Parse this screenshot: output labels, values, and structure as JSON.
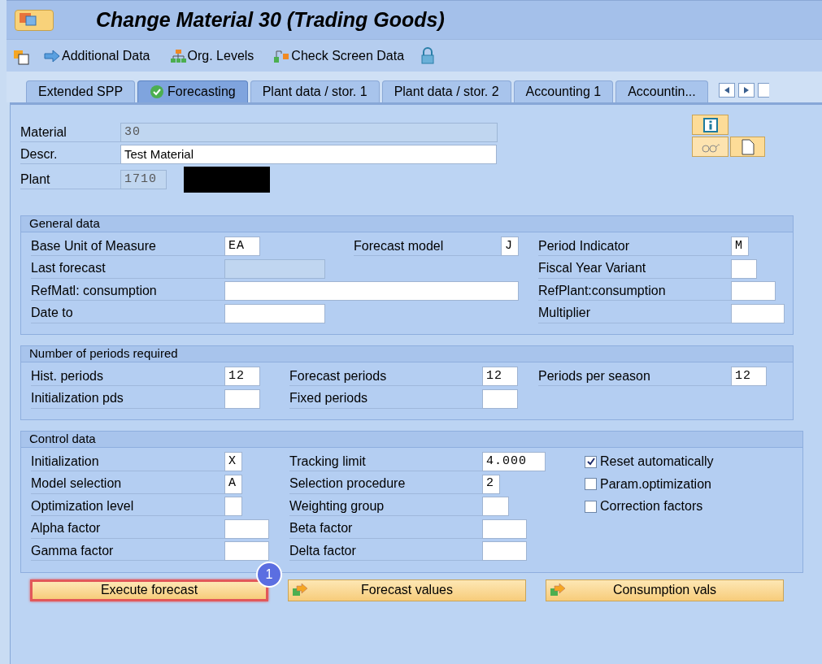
{
  "window": {
    "title": "Change Material 30 (Trading Goods)"
  },
  "toolbar": [
    {
      "kind": "icon"
    },
    {
      "label": "Additional Data",
      "kind": "arrow"
    },
    {
      "label": "Org. Levels",
      "kind": "tree"
    },
    {
      "label": "Check Screen Data",
      "kind": "check"
    },
    {
      "kind": "lock"
    }
  ],
  "tabs": [
    {
      "label": "Extended SPP",
      "selected": false
    },
    {
      "label": "Forecasting",
      "selected": true
    },
    {
      "label": "Plant data / stor. 1",
      "selected": false
    },
    {
      "label": "Plant data / stor. 2",
      "selected": false
    },
    {
      "label": "Accounting 1",
      "selected": false
    },
    {
      "label": "Accountin...",
      "selected": false
    }
  ],
  "header": [
    {
      "label": "Material",
      "value": "30",
      "disabled": true
    },
    {
      "label": "Descr.",
      "value": "Test Material",
      "disabled": false
    },
    {
      "label": "Plant",
      "value": "1710",
      "disabled": true
    }
  ],
  "sections": [
    {
      "title": "General data",
      "columns": [
        [
          {
            "kind": "field",
            "label": "Base Unit of Measure",
            "value": "EA",
            "disabled": false
          },
          {
            "kind": "field",
            "label": "Last forecast",
            "disabled": true
          },
          {
            "kind": "field",
            "label": "RefMatl: consumption",
            "disabled": false
          },
          {
            "kind": "field",
            "label": "Date to",
            "disabled": false
          }
        ],
        [
          {
            "kind": "field",
            "label": "Forecast model",
            "value": "J",
            "disabled": false
          }
        ],
        [
          {
            "kind": "field",
            "label": "Period Indicator",
            "value": "M",
            "disabled": false
          },
          {
            "kind": "field",
            "label": "Fiscal Year Variant",
            "disabled": false
          },
          {
            "kind": "field",
            "label": "RefPlant:consumption",
            "disabled": false
          },
          {
            "kind": "field",
            "label": "Multiplier",
            "disabled": false
          }
        ]
      ]
    },
    {
      "title": "Number of periods required",
      "columns": [
        [
          {
            "kind": "field",
            "label": "Hist. periods",
            "value": "12",
            "disabled": false
          },
          {
            "kind": "field",
            "label": "Initialization pds",
            "disabled": false
          }
        ],
        [
          {
            "kind": "field",
            "label": "Forecast periods",
            "value": "12",
            "disabled": false
          },
          {
            "kind": "field",
            "label": "Fixed periods",
            "disabled": false
          }
        ],
        [
          {
            "kind": "field",
            "label": "Periods per season",
            "value": "12",
            "disabled": false
          }
        ]
      ]
    },
    {
      "title": "Control data",
      "columns": [
        [
          {
            "kind": "field",
            "label": "Initialization",
            "value": "X",
            "disabled": false
          },
          {
            "kind": "field",
            "label": "Model selection",
            "value": "A",
            "disabled": false
          },
          {
            "kind": "field",
            "label": "Optimization level",
            "disabled": false
          },
          {
            "kind": "field",
            "label": "Alpha factor",
            "disabled": false
          },
          {
            "kind": "field",
            "label": "Gamma factor",
            "disabled": false
          }
        ],
        [
          {
            "kind": "field",
            "label": "Tracking limit",
            "value": "4.000",
            "disabled": false
          },
          {
            "kind": "field",
            "label": "Selection procedure",
            "value": "2",
            "disabled": false
          },
          {
            "kind": "field",
            "label": "Weighting group",
            "disabled": false
          },
          {
            "kind": "field",
            "label": "Beta factor",
            "disabled": false
          },
          {
            "kind": "field",
            "label": "Delta factor",
            "disabled": false
          }
        ],
        [
          {
            "kind": "checkbox",
            "label": "Reset automatically",
            "checked": true
          },
          {
            "kind": "checkbox",
            "label": "Param.optimization",
            "checked": false
          },
          {
            "kind": "checkbox",
            "label": "Correction factors",
            "checked": false
          }
        ]
      ]
    }
  ],
  "buttons": [
    {
      "label": "Execute forecast",
      "highlighted": true,
      "badge": "1"
    },
    {
      "label": "Forecast values",
      "highlighted": false
    },
    {
      "label": "Consumption vals",
      "highlighted": false
    }
  ]
}
